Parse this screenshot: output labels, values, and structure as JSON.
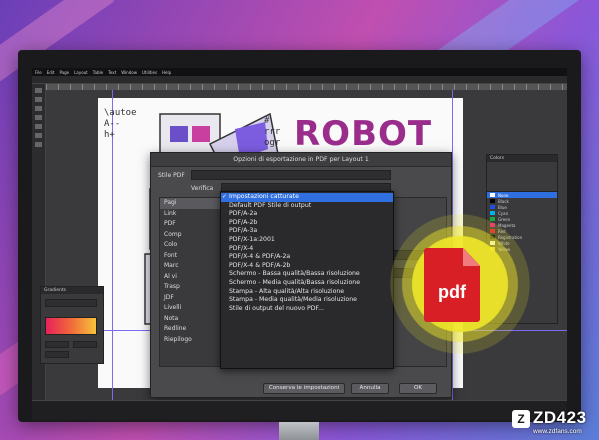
{
  "app": {
    "menu": [
      "File",
      "Edit",
      "Page",
      "Layout",
      "Table",
      "Text",
      "Window",
      "Utilities",
      "Help"
    ]
  },
  "artwork": {
    "title": "ROBOT",
    "code_lines_left": [
      "\\autoe",
      "A--",
      "h+ "
    ],
    "code_lines_right": [
      "#",
      "rrr",
      "ogr"
    ]
  },
  "dialog": {
    "title": "Opzioni di esportazione in PDF per Layout 1",
    "style_label": "Stile PDF",
    "verify_label": "Verifica",
    "sidebar_items": [
      "Pagi",
      "Link",
      "PDF",
      "Comp",
      "Colo",
      "Font",
      "Marc",
      "Al vi",
      "Trasp",
      "JDF",
      "Livelli",
      "Nota",
      "Redline",
      "Riepilogo"
    ],
    "content_label": "arati",
    "buttons": {
      "save": "Conserva le impostazioni",
      "cancel": "Annulla",
      "ok": "OK"
    }
  },
  "dropdown": {
    "items": [
      "Impostazioni catturate",
      "Default PDF Stile di output",
      "PDF/A-2a",
      "PDF/A-2b",
      "PDF/A-3a",
      "PDF/X-1a:2001",
      "PDF/X-4",
      "PDF/X-4 & PDF/A-2a",
      "PDF/X-4 & PDF/A-2b",
      "Schermo - Bassa qualità/Bassa risoluzione",
      "Schermo - Media qualità/Bassa risoluzione",
      "Stampa - Alta qualità/Alta risoluzione",
      "Stampa - Media qualità/Media risoluzione",
      "Stile di output del nuovo PDF..."
    ],
    "selected_index": 0
  },
  "colors_panel": {
    "title": "Colors",
    "swatches": [
      {
        "name": "None",
        "color": "#ffffff"
      },
      {
        "name": "Black",
        "color": "#000000"
      },
      {
        "name": "Blue",
        "color": "#1f4fe0"
      },
      {
        "name": "Cyan",
        "color": "#00b3e6"
      },
      {
        "name": "Green",
        "color": "#1fa83a"
      },
      {
        "name": "Magenta",
        "color": "#e0217a"
      },
      {
        "name": "Red",
        "color": "#e02020"
      },
      {
        "name": "Registration",
        "color": "#000000"
      },
      {
        "name": "White",
        "color": "#ffffff"
      },
      {
        "name": "Yellow",
        "color": "#f0e020"
      }
    ],
    "selected_index": 0
  },
  "gradient_panel": {
    "title": "Gradients"
  },
  "pdf_badge": {
    "label": "pdf"
  },
  "watermark": {
    "logo": "Z",
    "name": "ZD423",
    "url": "www.zdfans.com"
  }
}
